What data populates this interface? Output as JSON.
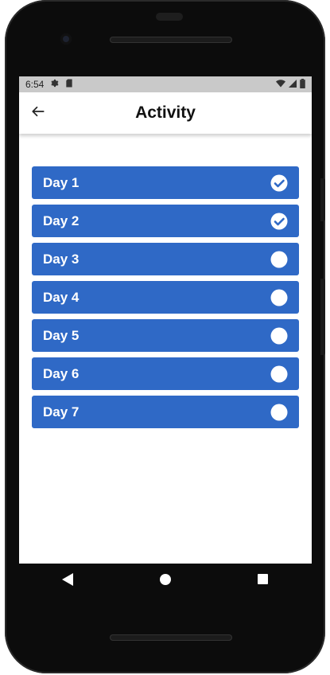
{
  "status_bar": {
    "time": "6:54",
    "left_icons": [
      "gear-icon",
      "sd-card-icon"
    ],
    "right_icons": [
      "wifi-icon",
      "signal-icon",
      "battery-icon"
    ]
  },
  "app_bar": {
    "title": "Activity",
    "back_icon": "arrow-left-icon"
  },
  "days": [
    {
      "label": "Day 1",
      "completed": true
    },
    {
      "label": "Day 2",
      "completed": true
    },
    {
      "label": "Day 3",
      "completed": false
    },
    {
      "label": "Day 4",
      "completed": false
    },
    {
      "label": "Day 5",
      "completed": false
    },
    {
      "label": "Day 6",
      "completed": false
    },
    {
      "label": "Day 7",
      "completed": false
    }
  ],
  "nav_bar": {
    "buttons": [
      "back-triangle-icon",
      "home-circle-icon",
      "recents-square-icon"
    ]
  },
  "colors": {
    "row_background": "#2f69c6",
    "row_text": "#ffffff",
    "status_bar": "#c9c9c9"
  }
}
